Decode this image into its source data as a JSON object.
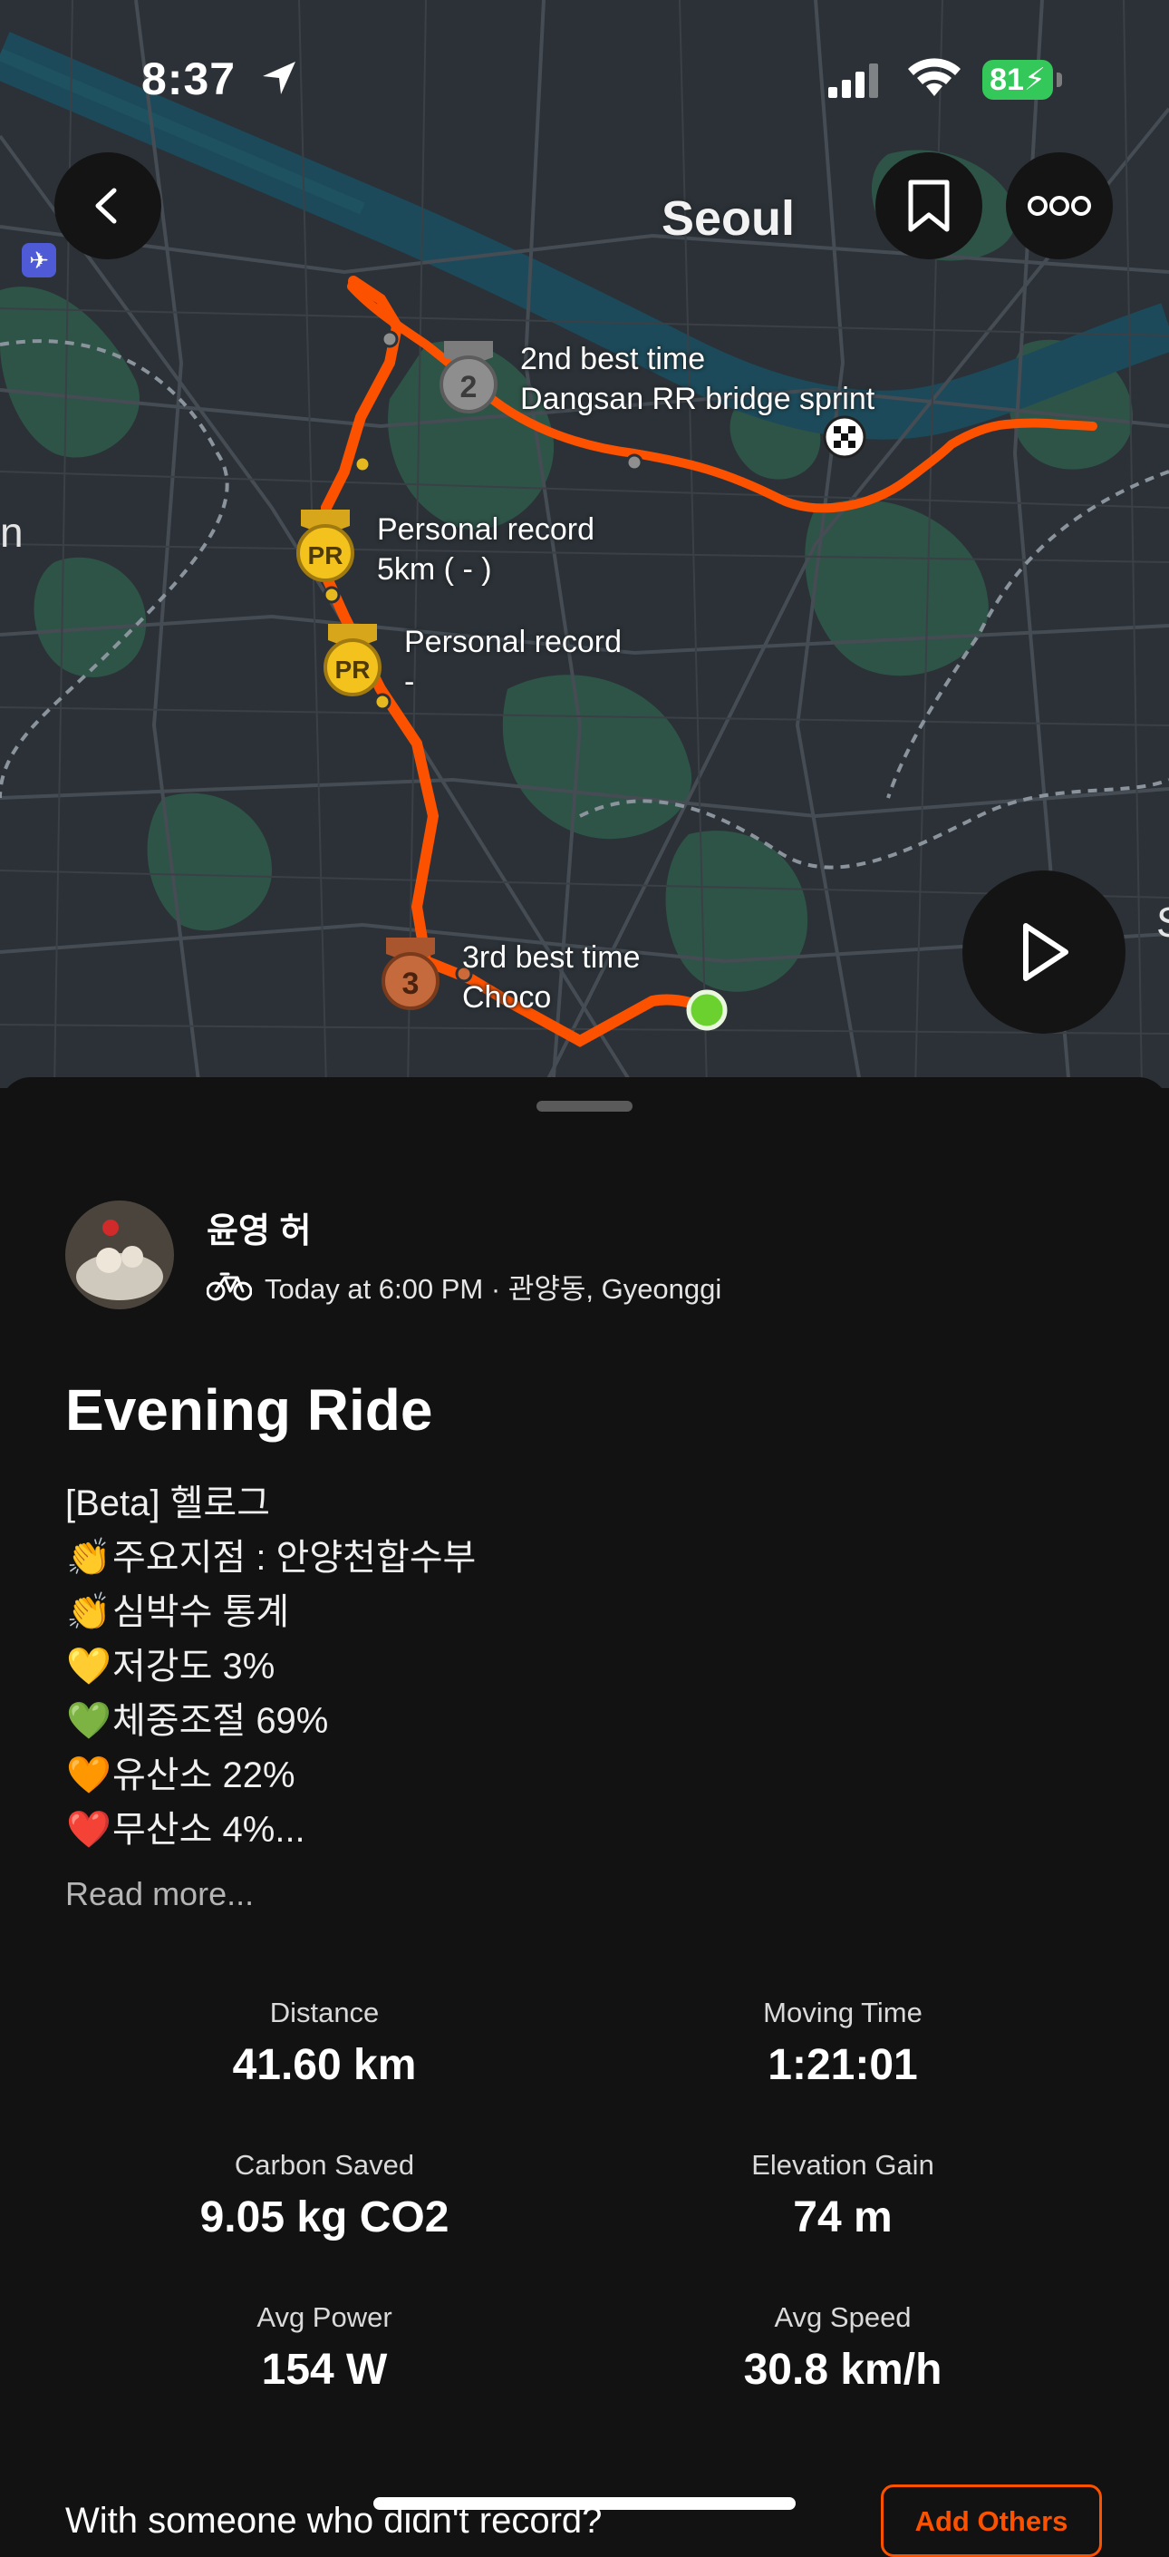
{
  "status_bar": {
    "time": "8:37",
    "battery": "81"
  },
  "map": {
    "city_label": "Seoul",
    "edge_label_left": "n",
    "edge_label_right": "S",
    "route_color": "#fc5200",
    "achievements": [
      {
        "rank_text": "2",
        "line1": "2nd best time",
        "line2": "Dangsan RR bridge sprint",
        "medal": "silver"
      },
      {
        "rank_text": "PR",
        "line1": "Personal record",
        "line2": "5km (    -  )",
        "medal": "gold"
      },
      {
        "rank_text": "PR",
        "line1": "Personal record",
        "line2": "-",
        "medal": "gold"
      },
      {
        "rank_text": "3",
        "line1": "3rd best time",
        "line2": "Choco",
        "medal": "bronze"
      }
    ],
    "icons": {
      "back": "chevron-left-icon",
      "bookmark": "bookmark-icon",
      "more": "more-icon",
      "play": "play-icon"
    }
  },
  "activity": {
    "athlete_name": "윤영 허",
    "meta": "Today at 6:00 PM · 관양동, Gyeonggi",
    "activity_type_icon": "bicycle-icon",
    "title": "Evening Ride",
    "description_lines": [
      {
        "emoji": "",
        "text": "[Beta] 헬로그"
      },
      {
        "emoji": "👏",
        "text": "주요지점 : 안양천합수부"
      },
      {
        "emoji": "👏",
        "text": "심박수 통계"
      },
      {
        "emoji": "💛",
        "text": "저강도 3%"
      },
      {
        "emoji": "💚",
        "text": "체중조절 69%"
      },
      {
        "emoji": "🧡",
        "text": "유산소 22%"
      },
      {
        "emoji": "❤️",
        "text": "무산소 4%..."
      }
    ],
    "read_more": "Read more...",
    "stats": [
      {
        "label": "Distance",
        "value": "41.60 km"
      },
      {
        "label": "Moving Time",
        "value": "1:21:01"
      },
      {
        "label": "Carbon Saved",
        "value": "9.05 kg CO2"
      },
      {
        "label": "Elevation Gain",
        "value": "74 m"
      },
      {
        "label": "Avg Power",
        "value": "154 W"
      },
      {
        "label": "Avg Speed",
        "value": "30.8 km/h"
      }
    ],
    "with_someone_text": "With someone who didn't record?",
    "add_others_label": "Add Others"
  },
  "colors": {
    "accent": "#fc5200",
    "background": "#121212",
    "map_base": "#2b3136",
    "park": "#2f5a4a",
    "river": "#1c4a5a"
  }
}
